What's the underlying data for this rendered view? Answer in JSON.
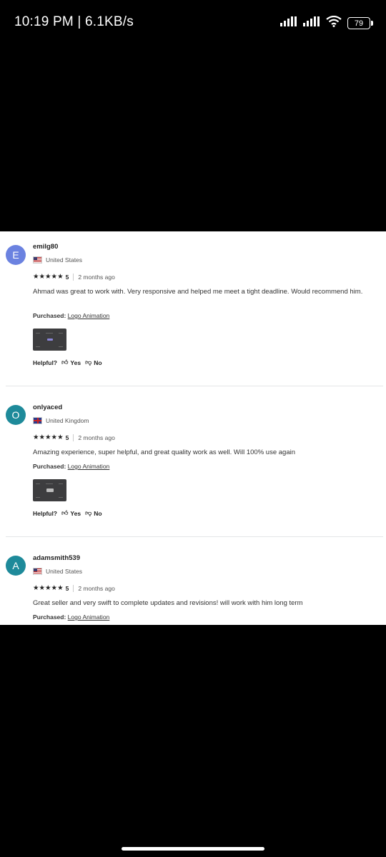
{
  "status_bar": {
    "time": "10:19 PM | 6.1KB/s",
    "battery": "79"
  },
  "reviews": [
    {
      "avatar_letter": "E",
      "avatar_color": "#6b82e0",
      "username": "emilg80",
      "country": "United States",
      "rating": "5",
      "date": "2 months ago",
      "text": "Ahmad was great to work with. Very responsive and helped me meet a tight deadline. Would recommend him.",
      "purchased_label": "Purchased:",
      "purchased_item": "Logo Animation",
      "helpful_label": "Helpful?",
      "yes_label": "Yes",
      "no_label": "No"
    },
    {
      "avatar_letter": "O",
      "avatar_color": "#1e8a9a",
      "username": "onlyaced",
      "country": "United Kingdom",
      "rating": "5",
      "date": "2 months ago",
      "text": "Amazing experience, super helpful, and great quality work as well. Will 100% use again",
      "purchased_label": "Purchased:",
      "purchased_item": "Logo Animation",
      "helpful_label": "Helpful?",
      "yes_label": "Yes",
      "no_label": "No"
    },
    {
      "avatar_letter": "A",
      "avatar_color": "#1e8a9a",
      "username": "adamsmith539",
      "country": "United States",
      "rating": "5",
      "date": "2 months ago",
      "text": "Great seller and very swift to complete updates and revisions! will work with him long term",
      "purchased_label": "Purchased:",
      "purchased_item": "Logo Animation"
    }
  ]
}
